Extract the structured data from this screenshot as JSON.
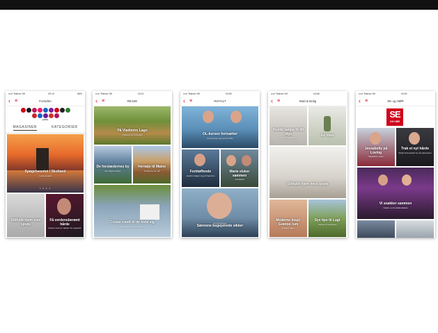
{
  "phones": [
    {
      "status": {
        "carrier": "••••• Telenor DK",
        "time": "09:12",
        "battery": "66%"
      },
      "nav_title": "Forsiden",
      "brand": "polike",
      "circle_colors": [
        "#d0021b",
        "#1a1a1a",
        "#c2185b",
        "#e91e63",
        "#1565c0",
        "#7b1fa2",
        "#d0021b",
        "#212121",
        "#2e7d32",
        "#c62828",
        "#1565c0",
        "#6a1b9a",
        "#d32f2f",
        "#ad1457"
      ],
      "tabs": [
        "MAGASINER",
        "KATEGORIER"
      ],
      "tiles": [
        {
          "title": "Spøgelsesslot i Skotland",
          "sub": "Lucas Hadad"
        },
        {
          "title": "Stilfuldt hjem med spejle",
          "sub": ""
        },
        {
          "title": "Få verdensberømt hårde",
          "sub": "Selena Gomez' skjulte Vin sugehair"
        }
      ]
    },
    {
      "status": {
        "carrier": "••••• Telenor DK",
        "time": "16:21",
        "battery": ""
      },
      "nav_title": "REJSE",
      "tiles": [
        {
          "title": "På Vladimirs Lago",
          "sub": "Tusindvis af vinmarker"
        },
        {
          "title": "De forstædernes by",
          "sub": "Der skjulte steder"
        },
        {
          "title": "Hernøje til Maine",
          "sub": "Turisterne ser på"
        },
        {
          "title": "Cruise rundt til de forbi sig",
          "sub": "Nu Pastour en mangehavne"
        }
      ]
    },
    {
      "status": {
        "carrier": "••••• Telenor DK",
        "time": "16:35",
        "battery": ""
      },
      "nav_title": "ROYALT",
      "tiles": [
        {
          "title": "OL-kursen fortsætter",
          "sub": "Kronprinsen genvandt til Rio"
        },
        {
          "title": "Forbløffende",
          "sub": "Joachim følger sig på Nørrebro"
        },
        {
          "title": "Marie elsker sammen",
          "sub": "Familietid"
        },
        {
          "title": "Sønnene begejstrede sikker",
          "sub": "Kronprinsesse"
        }
      ]
    },
    {
      "status": {
        "carrier": "••••• Telenor DK",
        "time": "16:48",
        "battery": ""
      },
      "nav_title": "Mad & Bolig",
      "tiles": [
        {
          "title": "Rustik lampe til dit dige",
          "sub": "Pris for dit design"
        },
        {
          "title": "Ad Vase",
          "sub": ""
        },
        {
          "title": "Stilfuldt hjem med spejle",
          "sub": ""
        },
        {
          "title": "Moderne Inspi-Grønne rum",
          "sub": "Køkken ideer"
        },
        {
          "title": "Syv tips til Lagt",
          "sub": "Perfekt til markhusd"
        }
      ]
    },
    {
      "status": {
        "carrier": "••••• Telenor DK",
        "time": "16:30",
        "battery": ""
      },
      "nav_title": "SE og HØR",
      "logo": {
        "big": "SE",
        "small": "OG HØR"
      },
      "tiles": [
        {
          "title": "Jessabelly på Loving",
          "sub": "Magasiner siden"
        },
        {
          "title": "Trak et nyt hårde",
          "sub": "Sarah Grünewald vie på spisestuen"
        },
        {
          "title": "Vi snakker sammen",
          "sub": "Kalder en fra fællesskabet"
        },
        {
          "title": "",
          "sub": ""
        }
      ]
    }
  ]
}
